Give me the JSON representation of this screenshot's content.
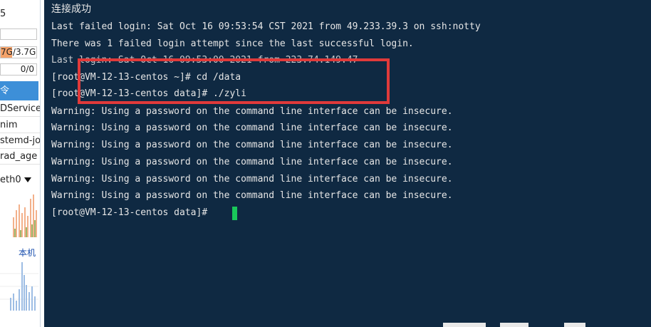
{
  "sidebar": {
    "top_number": "5",
    "memory_text": "7G/3.7G",
    "swap_text": "0/0",
    "active_item": "令",
    "processes": [
      "DService",
      "nim",
      "stemd-jo",
      "rad_age"
    ],
    "network_interface": "eth0",
    "local_label": "本机"
  },
  "terminal": {
    "lines": [
      "连接成功",
      "Last failed login: Sat Oct 16 09:53:54 CST 2021 from 49.233.39.3 on ssh:notty",
      "There was 1 failed login attempt since the last successful login.",
      "Last login: Sat Oct 16 09:53:00 2021 from 223.74.149.47",
      "[root@VM-12-13-centos ~]# cd /data",
      "[root@VM-12-13-centos data]# ./zyli",
      "Warning: Using a password on the command line interface can be insecure.",
      "Warning: Using a password on the command line interface can be insecure.",
      "Warning: Using a password on the command line interface can be insecure.",
      "Warning: Using a password on the command line interface can be insecure.",
      "Warning: Using a password on the command line interface can be insecure.",
      "Warning: Using a password on the command line interface can be insecure."
    ],
    "prompt": "[root@VM-12-13-centos data]# ",
    "colors": {
      "background": "#0f2942",
      "text": "#e6e6e6",
      "cursor": "#19c85a",
      "highlight_box": "#e03a3a"
    }
  }
}
